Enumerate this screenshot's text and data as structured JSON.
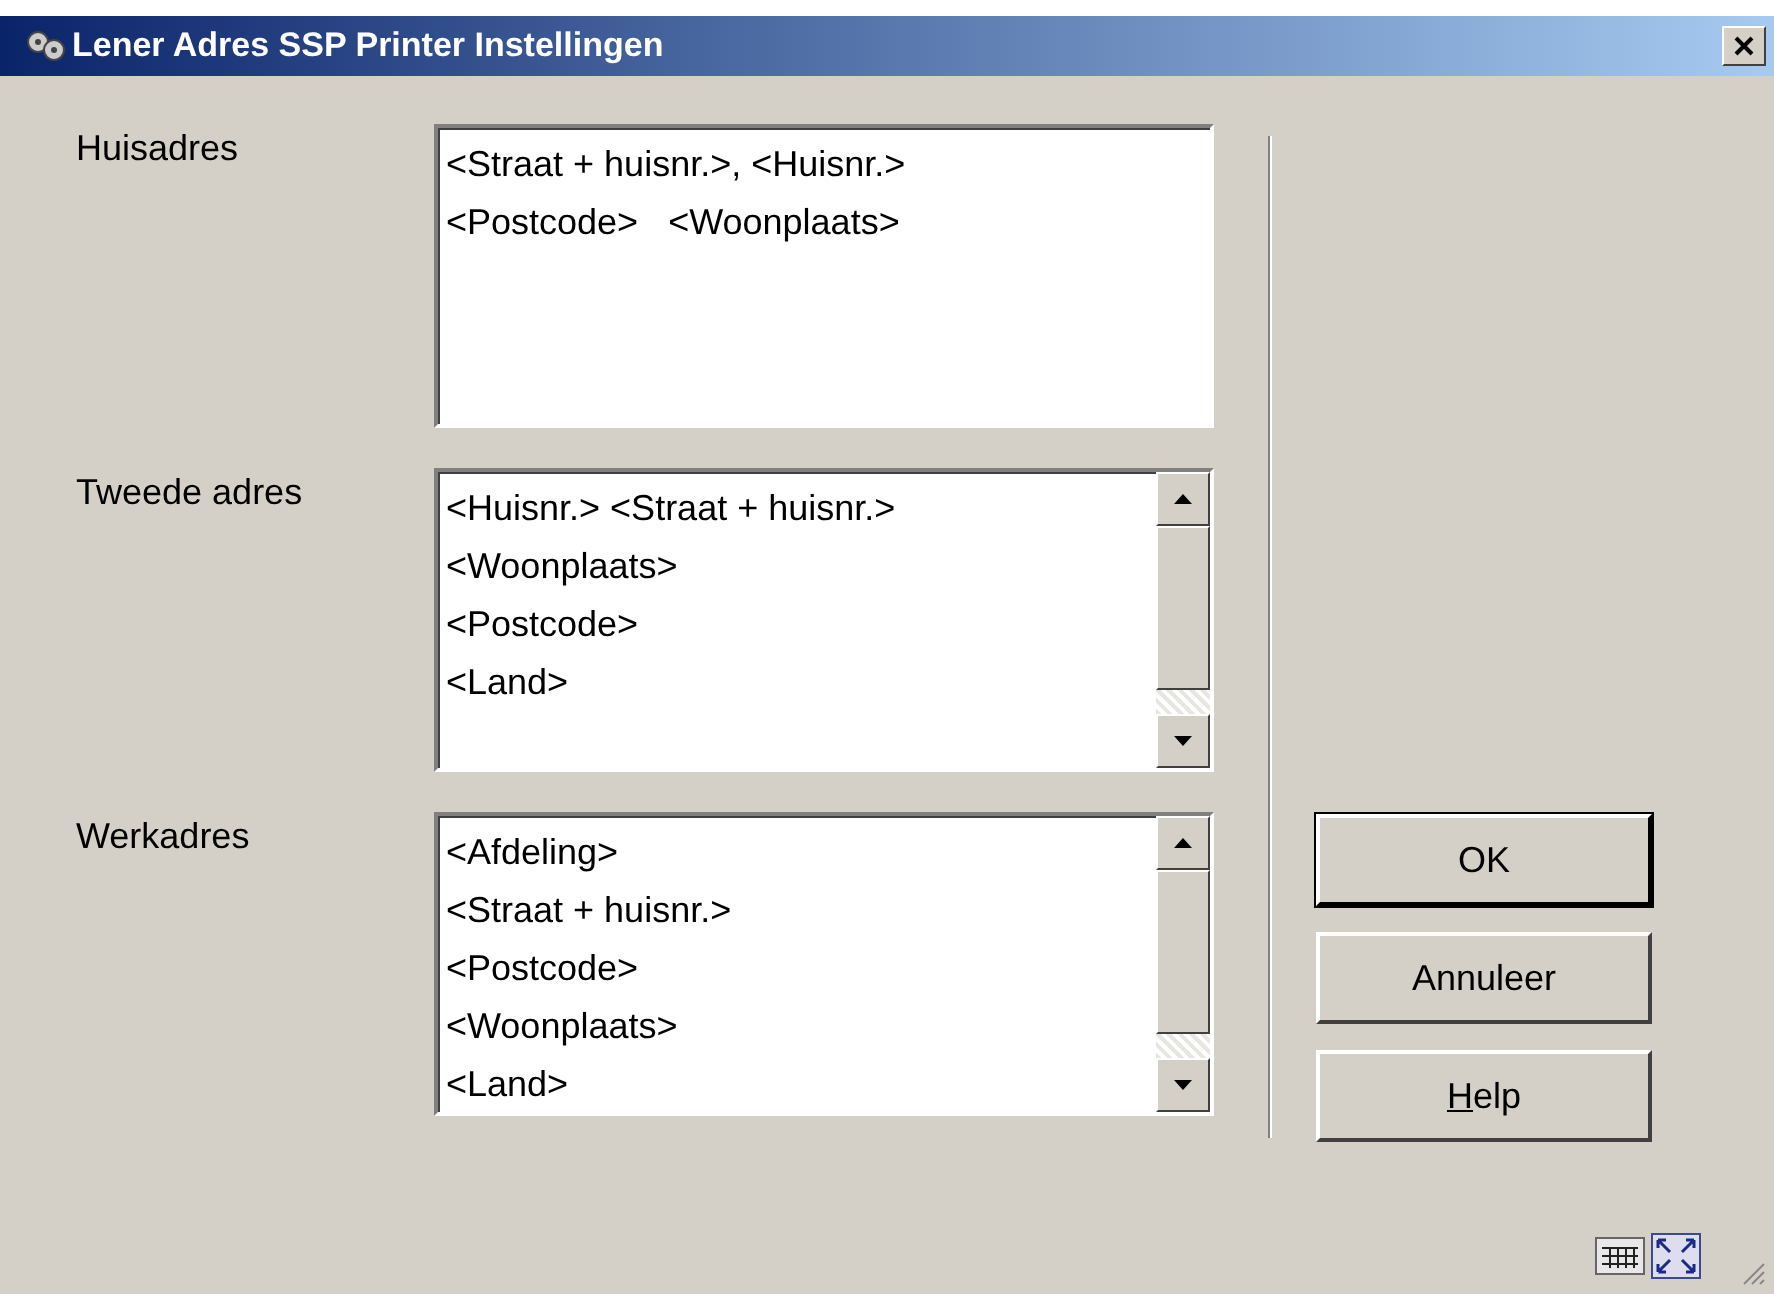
{
  "window": {
    "title": "Lener Adres SSP Printer Instellingen"
  },
  "fields": [
    {
      "label": "Huisadres",
      "scrollbar": false,
      "lines": [
        "<Straat + huisnr.>, <Huisnr.>",
        "<Postcode>   <Woonplaats>"
      ]
    },
    {
      "label": "Tweede adres",
      "scrollbar": true,
      "lines": [
        "<Huisnr.> <Straat + huisnr.>",
        "<Woonplaats>",
        "<Postcode>",
        "<Land>"
      ]
    },
    {
      "label": "Werkadres",
      "scrollbar": true,
      "lines": [
        "<Afdeling>",
        "<Straat + huisnr.>",
        "<Postcode>",
        "<Woonplaats>",
        "<Land>"
      ]
    }
  ],
  "buttons": [
    {
      "label": "OK",
      "default": true,
      "mnemonic": false
    },
    {
      "label": "Annuleer",
      "default": false,
      "mnemonic": false
    },
    {
      "label": "Help",
      "default": false,
      "mnemonic": true
    }
  ]
}
